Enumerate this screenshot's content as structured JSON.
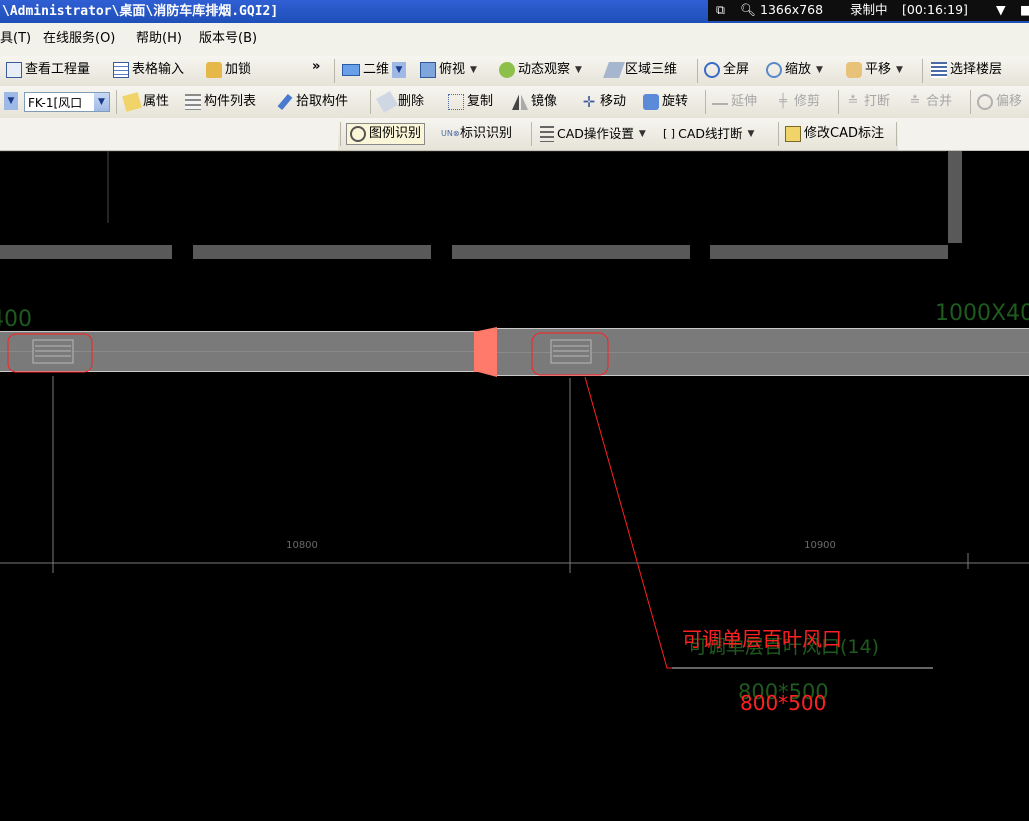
{
  "window": {
    "title": "\\Administrator\\桌面\\消防车库排烟.GQI2]"
  },
  "recorder": {
    "resolution": "1366x768",
    "status": "录制中",
    "timer": "[00:16:19]"
  },
  "menu": {
    "items": [
      "具(T)",
      "在线服务(O)",
      "帮助(H)",
      "版本号(B)"
    ]
  },
  "toolbar1": {
    "view_quantity": "查看工程量",
    "table_input": "表格输入",
    "lock": "加锁",
    "more": "»",
    "view_mode": "二维",
    "top_view": "俯视",
    "dynamic_view": "动态观察",
    "region_3d": "区域三维",
    "full_screen": "全屏",
    "zoom": "缩放",
    "pan": "平移",
    "select_floor": "选择楼层"
  },
  "toolbar2": {
    "component_select": "FK-1[风口",
    "properties": "属性",
    "component_list": "构件列表",
    "pick_component": "拾取构件",
    "delete": "删除",
    "copy": "复制",
    "mirror": "镜像",
    "move": "移动",
    "rotate": "旋转",
    "extend": "延伸",
    "trim": "修剪",
    "break": "打断",
    "merge": "合并",
    "offset": "偏移"
  },
  "toolbar3": {
    "legend_recognize": "图例识别",
    "label_recognize": "标识识别",
    "cad_settings": "CAD操作设置",
    "cad_line_break": "CAD线打断",
    "modify_cad_label": "修改CAD标注"
  },
  "drawing": {
    "duct_label_left": "400",
    "duct_label_right": "1000X40",
    "dim_left": "10800",
    "dim_right": "10900",
    "annotation_name": "可调单层百叶风口",
    "annotation_size": "800*500",
    "ghost_name": "可调单层百叶风口(14)",
    "ghost_size": "800*500",
    "colors": {
      "duct": "#7a7a7a",
      "red_marker": "#ff2020",
      "green_text": "#1f5a1f",
      "white_line": "#c8c8c8"
    }
  }
}
